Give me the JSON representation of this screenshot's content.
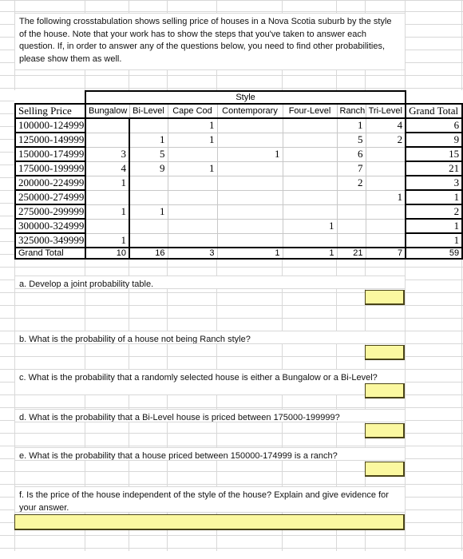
{
  "document": {
    "kind": "spreadsheet-worksheet",
    "accent_yellow": "#FBF8A0",
    "gridline_color": "#D8D8D8"
  },
  "prompt": {
    "text": "The following crosstabulation shows selling price of houses in a Nova Scotia suburb by the style of the house. Note that your work has to show the steps that you've taken to answer each question. If, in order to answer any of the questions below, you need to find other probabilities, please show them as well."
  },
  "crosstab": {
    "group_header": "Style",
    "row_header": "Selling Price",
    "grand_total_header": "Grand Total",
    "style_columns": [
      "Bungalow",
      "Bi-Level",
      "Cape Cod",
      "Contemporary",
      "Four-Level",
      "Ranch",
      "Tri-Level"
    ],
    "rows": [
      {
        "label": "100000-124999",
        "values": [
          "",
          "",
          "1",
          "",
          "",
          "1",
          "4"
        ],
        "total": "6"
      },
      {
        "label": "125000-149999",
        "values": [
          "",
          "1",
          "1",
          "",
          "",
          "5",
          "2"
        ],
        "total": "9"
      },
      {
        "label": "150000-174999",
        "values": [
          "3",
          "5",
          "",
          "1",
          "",
          "6",
          ""
        ],
        "total": "15"
      },
      {
        "label": "175000-199999",
        "values": [
          "4",
          "9",
          "1",
          "",
          "",
          "7",
          ""
        ],
        "total": "21"
      },
      {
        "label": "200000-224999",
        "values": [
          "1",
          "",
          "",
          "",
          "",
          "2",
          ""
        ],
        "total": "3"
      },
      {
        "label": "250000-274999",
        "values": [
          "",
          "",
          "",
          "",
          "",
          "",
          "1"
        ],
        "total": "1"
      },
      {
        "label": "275000-299999",
        "values": [
          "1",
          "1",
          "",
          "",
          "",
          "",
          ""
        ],
        "total": "2"
      },
      {
        "label": "300000-324999",
        "values": [
          "",
          "",
          "",
          "",
          "1",
          "",
          ""
        ],
        "total": "1"
      },
      {
        "label": "325000-349999",
        "values": [
          "1",
          "",
          "",
          "",
          "",
          "",
          ""
        ],
        "total": "1"
      }
    ],
    "grand_total_row": {
      "label": "Grand Total",
      "values": [
        "10",
        "16",
        "3",
        "1",
        "1",
        "21",
        "7"
      ],
      "total": "59"
    }
  },
  "questions": [
    {
      "id": "a",
      "text": "a. Develop a joint probability table.",
      "answer": ""
    },
    {
      "id": "b",
      "text": "b. What is the probability of a house not being Ranch style?",
      "answer": ""
    },
    {
      "id": "c",
      "text": "c. What is the probability that a randomly selected house is either a Bungalow or a Bi-Level?",
      "answer": ""
    },
    {
      "id": "d",
      "text": "d. What is the probability that a Bi-Level house is priced between 175000-199999?",
      "answer": ""
    },
    {
      "id": "e",
      "text": "e. What is the probability that a house priced between 150000-174999 is a ranch?",
      "answer": ""
    },
    {
      "id": "f",
      "text": "f. Is the price of the house independent of the style of the house? Explain and give evidence for your answer.",
      "answer": ""
    }
  ]
}
